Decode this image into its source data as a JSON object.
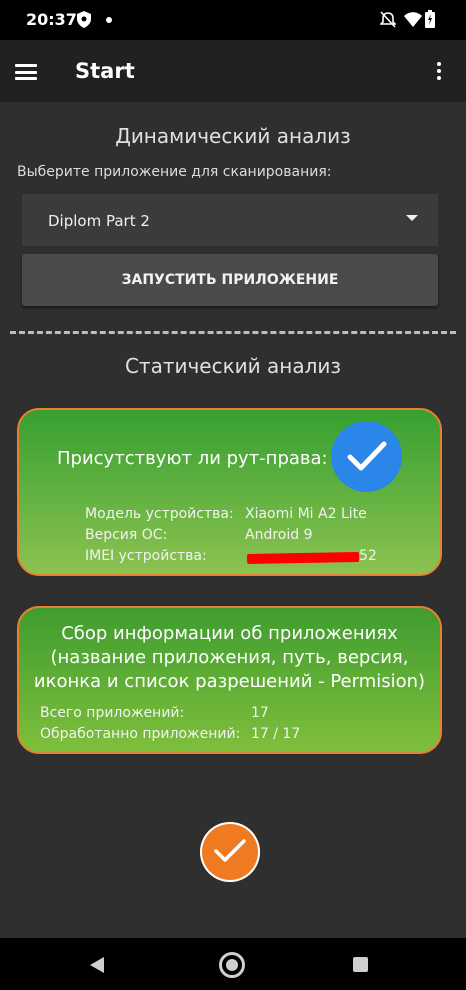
{
  "status_bar": {
    "time": "20:37",
    "icons": [
      "shield-icon",
      "dot-icon",
      "mute-bell-icon",
      "wifi-icon",
      "battery-icon"
    ]
  },
  "app_bar": {
    "title": "Start",
    "menu_icon": "hamburger-icon",
    "overflow_icon": "more-vert-icon"
  },
  "dynamic": {
    "title": "Динамический анализ",
    "hint": "Выберите приложение для сканирования:",
    "selected_app": "Diplom Part 2",
    "launch_button": "ЗАПУСТИТЬ ПРИЛОЖЕНИЕ"
  },
  "static": {
    "title": "Статический анализ",
    "root_card": {
      "question": "Присутствуют ли рут-права:",
      "status_icon": "check-circle-icon",
      "model_label": "Модель устройства:",
      "model_value": "Xiaomi Mi A2 Lite",
      "os_label": "Версия ОС:",
      "os_value": "Android 9",
      "imei_label": "IMEI устройства:",
      "imei_value_visible": "52"
    },
    "apps_card": {
      "heading_line1": "Сбор информации об приложениях",
      "heading_line2": "(название приложения, путь, версия,",
      "heading_line3": "иконка и список разрешений - Permision)",
      "total_label": "Всего приложений:",
      "total_value": "17",
      "processed_label": "Обработанно приложений:",
      "processed_value": "17 / 17"
    }
  },
  "colors": {
    "accent_orange": "#f07a22",
    "card_green_top": "#36a030",
    "card_green_bottom": "#8cc251",
    "check_blue": "#2a86e8"
  }
}
